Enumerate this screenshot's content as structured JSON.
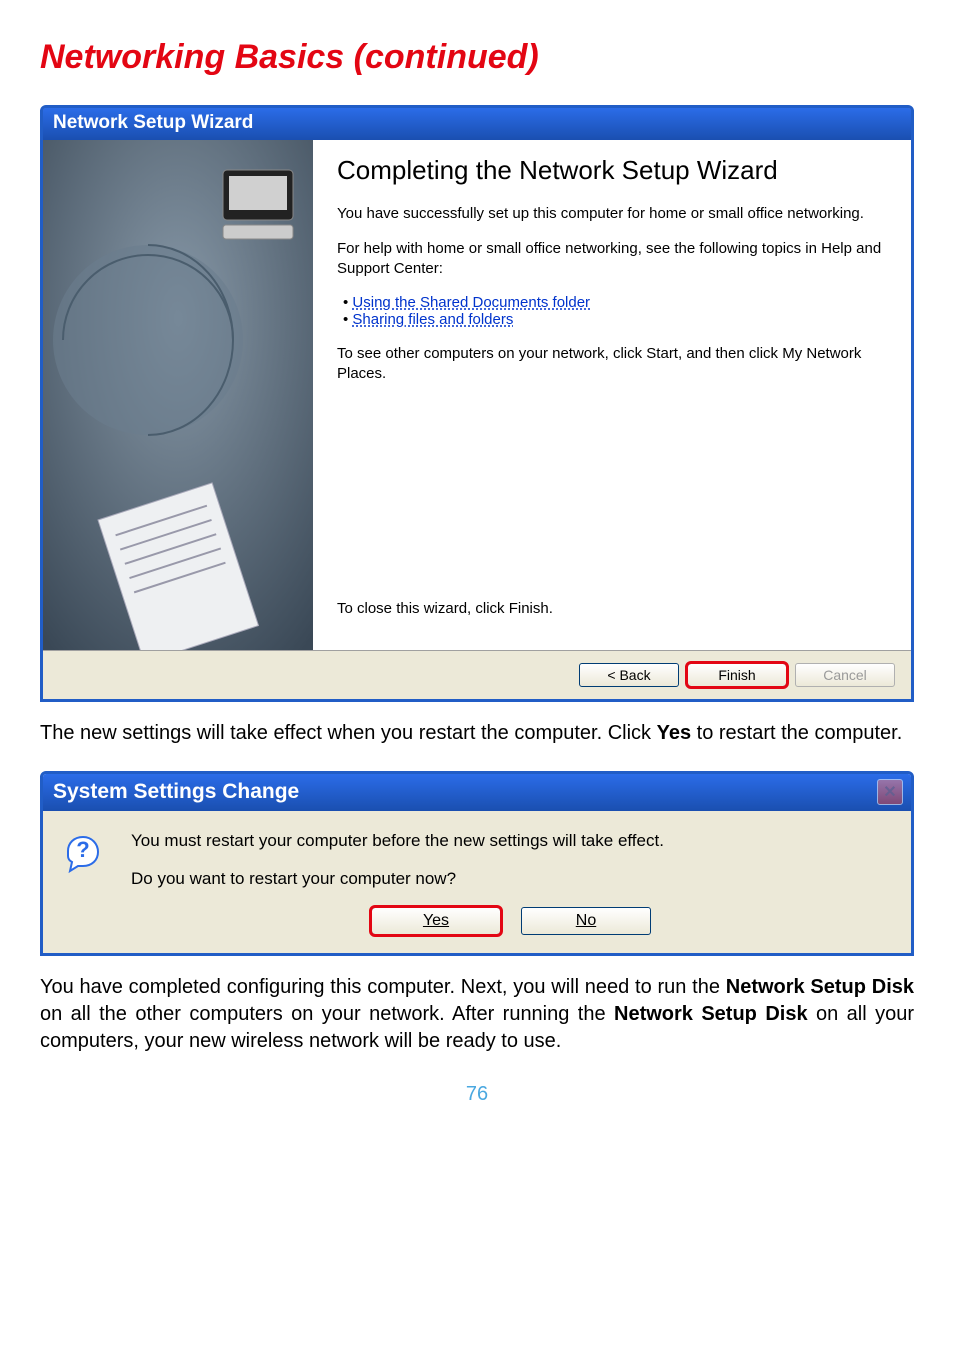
{
  "page": {
    "title": "Networking Basics (continued)",
    "number": "76"
  },
  "wizard": {
    "titlebar": "Network Setup Wizard",
    "heading": "Completing the Network Setup Wizard",
    "para1": "You have successfully set up this computer for home or small office networking.",
    "para2": "For help with home or small office networking, see the following topics in Help and Support Center:",
    "link1": "Using the Shared Documents folder",
    "link2": "Sharing files and folders",
    "para3": "To see other computers on your network, click Start, and then click My Network Places.",
    "para4": "To close this wizard, click Finish.",
    "buttons": {
      "back": "< Back",
      "finish": "Finish",
      "cancel": "Cancel"
    }
  },
  "body1_pre": "The new settings will take effect when you restart the computer. Click ",
  "body1_bold": "Yes",
  "body1_post": " to restart the computer.",
  "msgbox": {
    "titlebar": "System Settings Change",
    "line1": "You must restart your computer before the new settings will take effect.",
    "line2": "Do you want to restart your computer now?",
    "yes": "Yes",
    "no": "No"
  },
  "body2_a": "You have completed configuring this computer.  Next, you will need to run the ",
  "body2_b": "Network Setup Disk",
  "body2_c": " on all the other computers on your network. After running the ",
  "body2_d": "Network Setup Disk",
  "body2_e": " on all your computers, your new wireless network will be ready to use."
}
